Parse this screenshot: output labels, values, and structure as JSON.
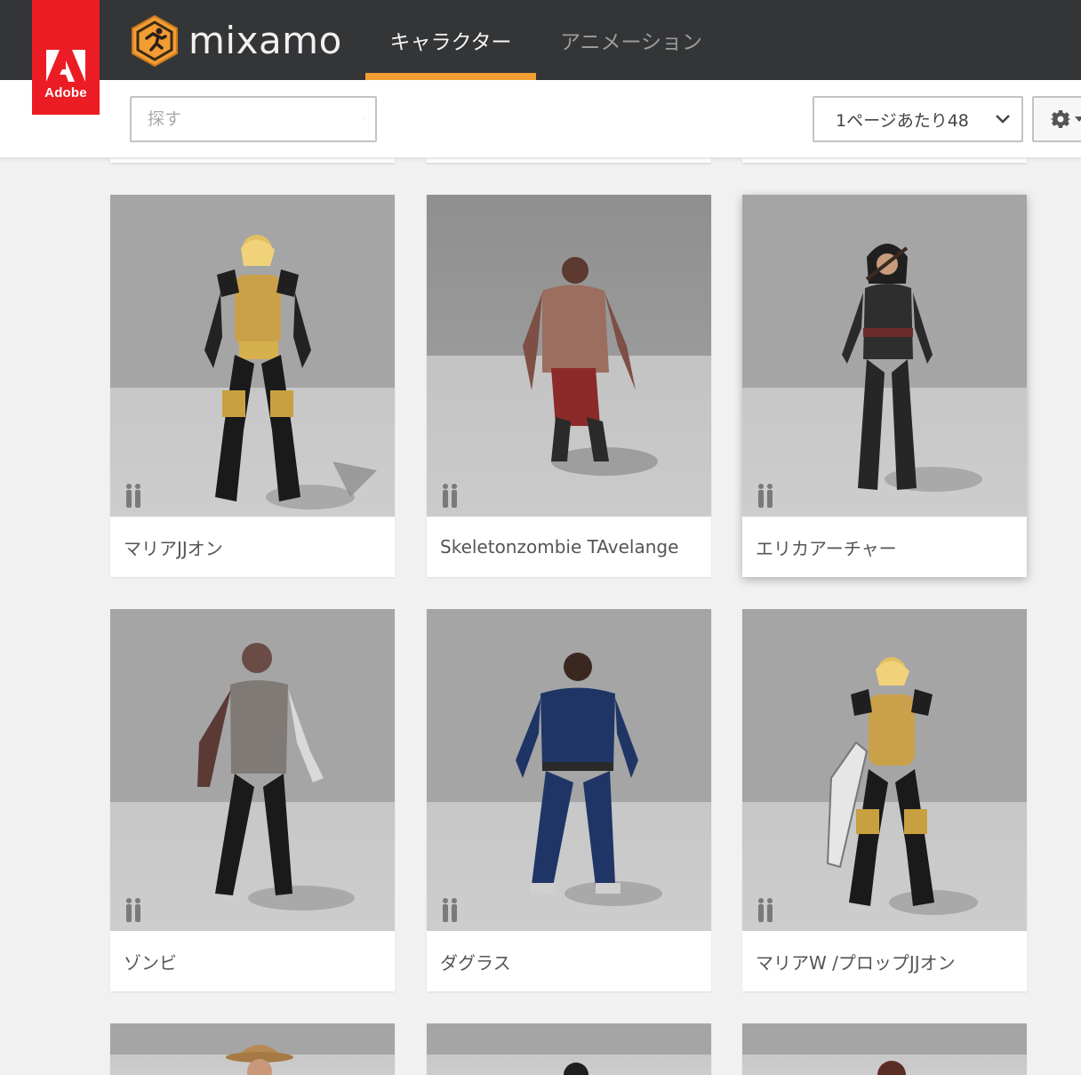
{
  "adobe": {
    "label": "Adobe"
  },
  "brand": {
    "name": "mixamo"
  },
  "nav": {
    "tabs": [
      {
        "label": "キャラクター",
        "active": true
      },
      {
        "label": "アニメーション",
        "active": false
      }
    ]
  },
  "toolbar": {
    "search_placeholder": "探す",
    "per_page": "1ページあたり48"
  },
  "colors": {
    "topbar": "#333537",
    "accent": "#f29c34",
    "adobe_red": "#ec1c24"
  },
  "characters": [
    {
      "name": "マリアJJオン"
    },
    {
      "name": "Skeletonzombie TAvelange"
    },
    {
      "name": "エリカアーチャー"
    },
    {
      "name": "ゾンビ"
    },
    {
      "name": "ダグラス"
    },
    {
      "name": "マリアW /プロップJJオン"
    }
  ]
}
